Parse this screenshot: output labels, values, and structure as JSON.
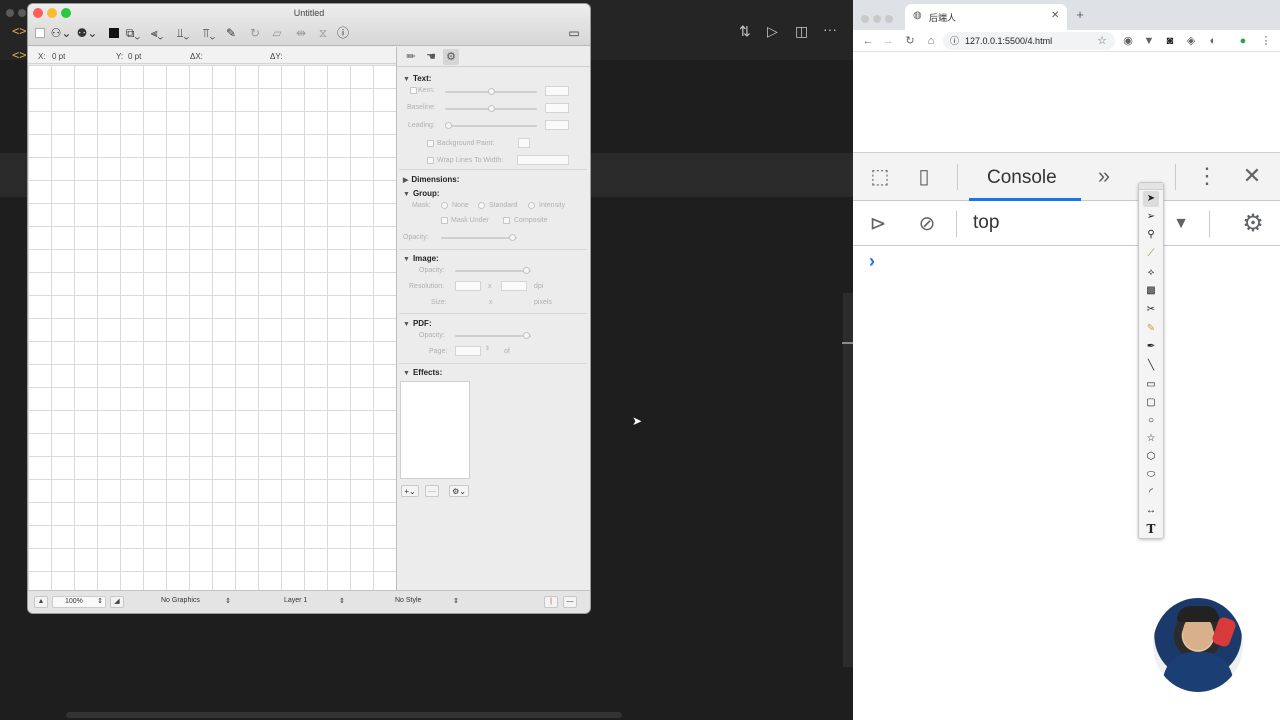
{
  "editor": {
    "chevron_glyph": "<>",
    "toolbar_icons": [
      "source-control-icon",
      "run-icon",
      "split-editor-icon",
      "more-icon"
    ]
  },
  "app": {
    "title": "Untitled",
    "coords": {
      "x_label": "X:",
      "x_value": "0 pt",
      "y_label": "Y:",
      "y_value": "0 pt",
      "dx_label": "ΔX:",
      "dy_label": "ΔY:"
    },
    "inspector": {
      "text": {
        "heading": "Text:",
        "kern": "Kern:",
        "baseline": "Baseline:",
        "leading": "Leading:",
        "background_paint": "Background Paint:",
        "wrap_lines": "Wrap Lines To Width:"
      },
      "dimensions": {
        "heading": "Dimensions:"
      },
      "group": {
        "heading": "Group:",
        "mask": "Mask:",
        "mask_options": [
          "None",
          "Standard",
          "Intensity"
        ],
        "mask_under": "Mask Under",
        "composite": "Composite",
        "opacity": "Opacity:"
      },
      "image": {
        "heading": "Image:",
        "opacity": "Opacity:",
        "resolution": "Resolution:",
        "x_sep": "x",
        "dpi": "dpi",
        "size": "Size:",
        "size_sep": "x",
        "pixels": "pixels"
      },
      "pdf": {
        "heading": "PDF:",
        "opacity": "Opacity:",
        "page": "Page:",
        "of": "of"
      },
      "effects": {
        "heading": "Effects:",
        "add": "+",
        "remove": "—",
        "gear": "⚙"
      }
    },
    "statusbar": {
      "zoom": "100%",
      "graphics": "No Graphics",
      "layer": "Layer 1",
      "style": "No Style"
    }
  },
  "browser": {
    "tab_title": "后端人",
    "url": "127.0.0.1:5500/4.html",
    "devtools": {
      "active_tab": "Console",
      "more_tabs": "»",
      "context": "top",
      "prompt": "›"
    }
  },
  "palette": {
    "tools": [
      "select-arrow-icon",
      "direct-select-icon",
      "zoom-icon",
      "ruler-icon",
      "eyedropper-icon",
      "gradient-icon",
      "scissors-icon",
      "pencil-icon",
      "pen-icon",
      "line-icon",
      "rectangle-icon",
      "rounded-rect-icon",
      "circle-icon",
      "star-icon",
      "polygon-icon",
      "ellipse-icon",
      "arc-icon",
      "dimension-icon",
      "text-tool-icon"
    ],
    "text_tool_label": "T"
  }
}
